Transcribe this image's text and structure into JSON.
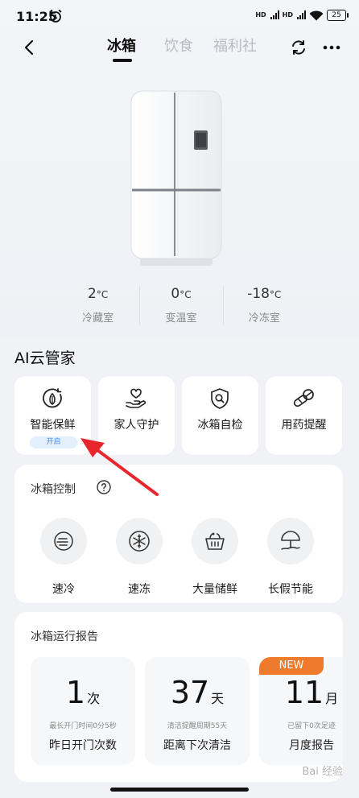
{
  "status_bar": {
    "time": "11:25",
    "battery": "25",
    "signal_label_1": "HD",
    "signal_label_2": "HD"
  },
  "nav": {
    "tabs": [
      {
        "label": "冰箱",
        "active": true
      },
      {
        "label": "饮食",
        "active": false
      },
      {
        "label": "福利社",
        "active": false
      }
    ]
  },
  "temperatures": [
    {
      "value": "2",
      "unit": "°C",
      "label": "冷藏室"
    },
    {
      "value": "0",
      "unit": "°C",
      "label": "变温室"
    },
    {
      "value": "-18",
      "unit": "°C",
      "label": "冷冻室"
    }
  ],
  "ai_section": {
    "title": "AI云管家",
    "cards": [
      {
        "label": "智能保鲜",
        "icon": "leaf-circle-icon",
        "badge": "开启"
      },
      {
        "label": "家人守护",
        "icon": "heart-hand-icon"
      },
      {
        "label": "冰箱自检",
        "icon": "shield-search-icon"
      },
      {
        "label": "用药提醒",
        "icon": "pill-icon"
      }
    ]
  },
  "control": {
    "title": "冰箱控制",
    "items": [
      {
        "label": "速冷",
        "icon": "fast-cool-icon"
      },
      {
        "label": "速冻",
        "icon": "snowflake-icon"
      },
      {
        "label": "大量储鲜",
        "icon": "basket-icon"
      },
      {
        "label": "长假节能",
        "icon": "beach-umbrella-icon"
      }
    ]
  },
  "report": {
    "title": "冰箱运行报告",
    "cards": [
      {
        "value": "1",
        "unit": "次",
        "sub": "最长开门时间0分5秒",
        "label": "昨日开门次数"
      },
      {
        "value": "37",
        "unit": "天",
        "sub": "清洁提醒周期55天",
        "label": "距离下次清洁"
      },
      {
        "value": "11",
        "unit": "月",
        "sub": "已留下0次足迹",
        "label": "月度报告",
        "badge": "NEW"
      }
    ]
  },
  "watermark": "Bai 经验",
  "colors": {
    "accent_blue": "#4a8ff0",
    "badge_orange": "#f07a2c",
    "arrow_red": "#e8262d"
  }
}
